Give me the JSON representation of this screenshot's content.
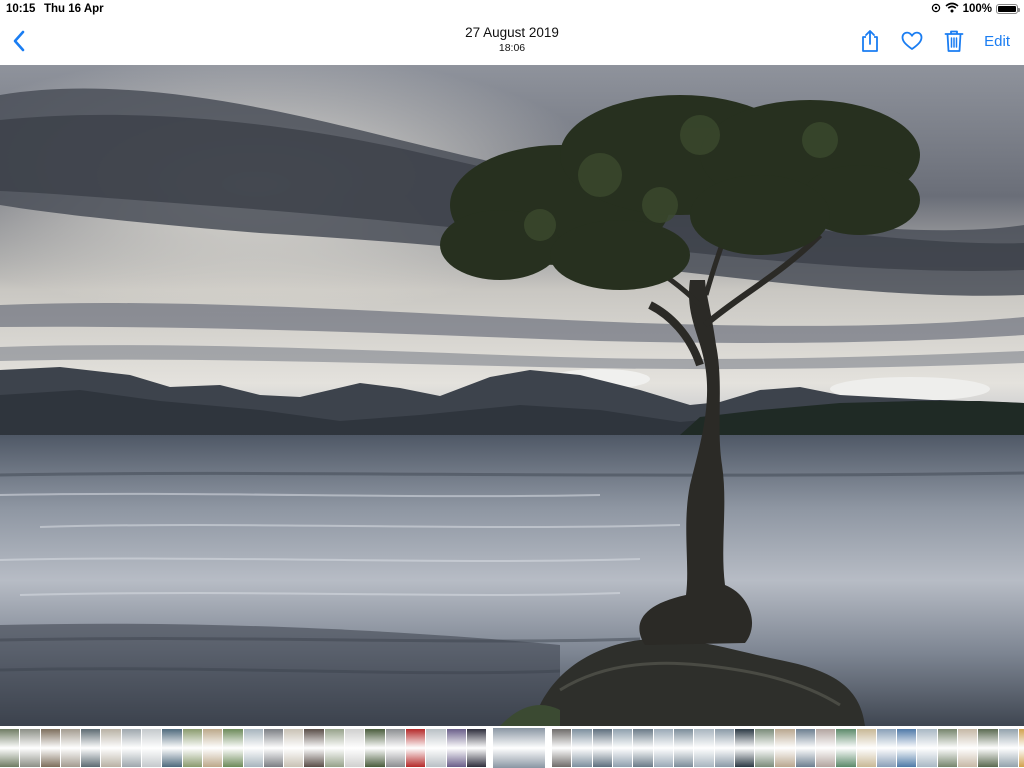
{
  "status": {
    "time": "10:15",
    "date": "Thu 16 Apr",
    "battery": "100%",
    "battery_level": 1.0
  },
  "nav": {
    "back_icon": "chevron-left-icon",
    "title_date": "27 August 2019",
    "title_time": "18:06",
    "actions": {
      "share_icon": "share-icon",
      "favorite_icon": "heart-icon",
      "delete_icon": "trash-icon",
      "edit_label": "Edit"
    }
  },
  "colors": {
    "accent": "#1a7df2"
  },
  "photo": {
    "subject": "lake-tree-photo"
  },
  "filmstrip": {
    "current_index": 24,
    "thumbnails": [
      "#6f7c63",
      "#8c8f86",
      "#7d6e5c",
      "#a39b8f",
      "#5d6b72",
      "#b8b1a4",
      "#9ea7ad",
      "#c4c9cc",
      "#4f6a7d",
      "#8a9b6e",
      "#bca88a",
      "#6d8b5a",
      "#a7b4bd",
      "#7c7f84",
      "#c9c2b5",
      "#5a4e48",
      "#96a28a",
      "#d0d0cf",
      "#4a5d3d",
      "#8c8e91",
      "#b52a2a",
      "#b9c0c5",
      "#6a5f8a",
      "#2f2f3d",
      "#8a96a3",
      "#6f6c6a",
      "#7d8f9e",
      "#5e6f7e",
      "#8fa0ae",
      "#6a7b88",
      "#9aa9b6",
      "#7c8d9a",
      "#a8b5bf",
      "#8b9aa7",
      "#2c3a45",
      "#7b8c7a",
      "#b9a78f",
      "#6d7f90",
      "#b3a5a0",
      "#5c8a6a",
      "#c8b896",
      "#8aa0b8",
      "#4f7aa8",
      "#a9b8c4",
      "#76856d",
      "#c6b8a6",
      "#5b6a51",
      "#94a3ad",
      "#d1a14e",
      "#7f9db7",
      "#b0bcc6",
      "#6a7a84"
    ]
  }
}
